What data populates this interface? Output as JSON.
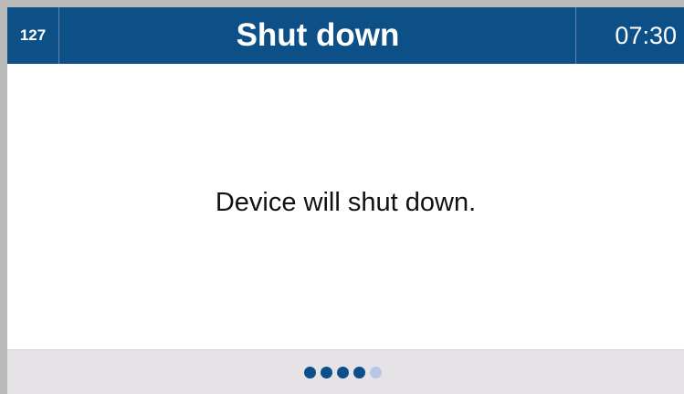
{
  "header": {
    "id_label": "127",
    "title": "Shut down",
    "time": "07:30"
  },
  "content": {
    "message": "Device will shut down."
  },
  "progress": {
    "total_dots": 5,
    "filled_dots": 4
  },
  "colors": {
    "header_bg": "#0d5087",
    "dot_active": "#0d4f8b",
    "dot_inactive": "#b6c8e3",
    "footer_bg": "#e6e3e6"
  }
}
